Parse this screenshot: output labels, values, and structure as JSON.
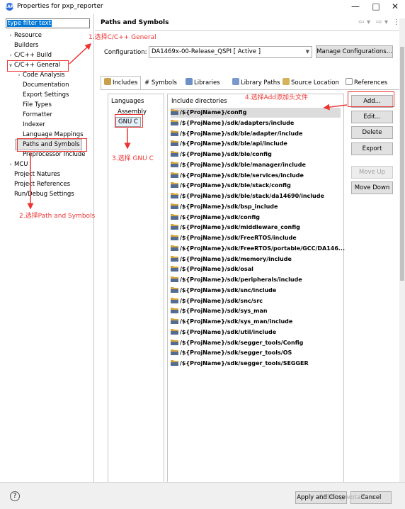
{
  "window": {
    "title": "Properties for pxp_reporter",
    "app_icon": "IAR"
  },
  "filter": {
    "value": "type filter text"
  },
  "tree": [
    {
      "label": "Resource",
      "twisty": ">",
      "indent": 0
    },
    {
      "label": "Builders",
      "twisty": "",
      "indent": 0
    },
    {
      "label": "C/C++ Build",
      "twisty": ">",
      "indent": 0
    },
    {
      "label": "C/C++ General",
      "twisty": "v",
      "indent": 0
    },
    {
      "label": "Code Analysis",
      "twisty": ">",
      "indent": 1
    },
    {
      "label": "Documentation",
      "twisty": "",
      "indent": 1
    },
    {
      "label": "Export Settings",
      "twisty": "",
      "indent": 1
    },
    {
      "label": "File Types",
      "twisty": "",
      "indent": 1
    },
    {
      "label": "Formatter",
      "twisty": "",
      "indent": 1
    },
    {
      "label": "Indexer",
      "twisty": "",
      "indent": 1
    },
    {
      "label": "Language Mappings",
      "twisty": "",
      "indent": 1
    },
    {
      "label": "Paths and Symbols",
      "twisty": "",
      "indent": 1,
      "selected": true
    },
    {
      "label": "Preprocessor Include",
      "twisty": "",
      "indent": 1
    },
    {
      "label": "MCU",
      "twisty": ">",
      "indent": 0
    },
    {
      "label": "Project Natures",
      "twisty": "",
      "indent": 0
    },
    {
      "label": "Project References",
      "twisty": "",
      "indent": 0
    },
    {
      "label": "Run/Debug Settings",
      "twisty": "",
      "indent": 0
    }
  ],
  "page": {
    "title": "Paths and Symbols"
  },
  "config": {
    "label": "Configuration:",
    "value": "DA1469x-00-Release_QSPI  [ Active ]",
    "manage_label": "Manage Configurations..."
  },
  "tabs": [
    {
      "label": "Includes",
      "icon": "includes-icon",
      "active": true
    },
    {
      "label": "# Symbols",
      "icon": "",
      "active": false
    },
    {
      "label": "Libraries",
      "icon": "libraries-icon",
      "active": false
    },
    {
      "label": "Library Paths",
      "icon": "library-paths-icon",
      "active": false
    },
    {
      "label": "Source Location",
      "icon": "source-location-icon",
      "active": false
    },
    {
      "label": "References",
      "icon": "references-icon",
      "active": false
    }
  ],
  "languages": {
    "header": "Languages",
    "items": [
      "Assembly",
      "GNU C"
    ],
    "selected": "GNU C"
  },
  "includes": {
    "header": "Include directories",
    "items": [
      "/${ProjName}/config",
      "/${ProjName}/sdk/adapters/include",
      "/${ProjName}/sdk/ble/adapter/include",
      "/${ProjName}/sdk/ble/api/include",
      "/${ProjName}/sdk/ble/config",
      "/${ProjName}/sdk/ble/manager/include",
      "/${ProjName}/sdk/ble/services/include",
      "/${ProjName}/sdk/ble/stack/config",
      "/${ProjName}/sdk/ble/stack/da14690/include",
      "/${ProjName}/sdk/bsp_include",
      "/${ProjName}/sdk/config",
      "/${ProjName}/sdk/middleware_config",
      "/${ProjName}/sdk/FreeRTOS/include",
      "/${ProjName}/sdk/FreeRTOS/portable/GCC/DA146...",
      "/${ProjName}/sdk/memory/include",
      "/${ProjName}/sdk/osal",
      "/${ProjName}/sdk/peripherals/include",
      "/${ProjName}/sdk/snc/include",
      "/${ProjName}/sdk/snc/src",
      "/${ProjName}/sdk/sys_man",
      "/${ProjName}/sdk/sys_man/include",
      "/${ProjName}/sdk/util/include",
      "/${ProjName}/sdk/segger_tools/Config",
      "/${ProjName}/sdk/segger_tools/OS",
      "/${ProjName}/sdk/segger_tools/SEGGER"
    ]
  },
  "buttons": {
    "add": "Add...",
    "edit": "Edit...",
    "delete": "Delete",
    "export": "Export",
    "move_up": "Move Up",
    "move_down": "Move Down"
  },
  "footer": {
    "apply_close": "Apply and Close",
    "cancel": "Cancel"
  },
  "annotations": {
    "step1": "1.选择C/C++ General",
    "step2": "2.选择Path and Symbols",
    "step3": "3.选择 GNU C",
    "step4": "4.选择Add添加头文件",
    "color": "#e33333"
  },
  "watermark": "CSDN @wotaifuzao",
  "colors": {
    "selection": "#0078d7",
    "folder": "#d9a53a",
    "folder_accent": "#2f5fa8"
  }
}
